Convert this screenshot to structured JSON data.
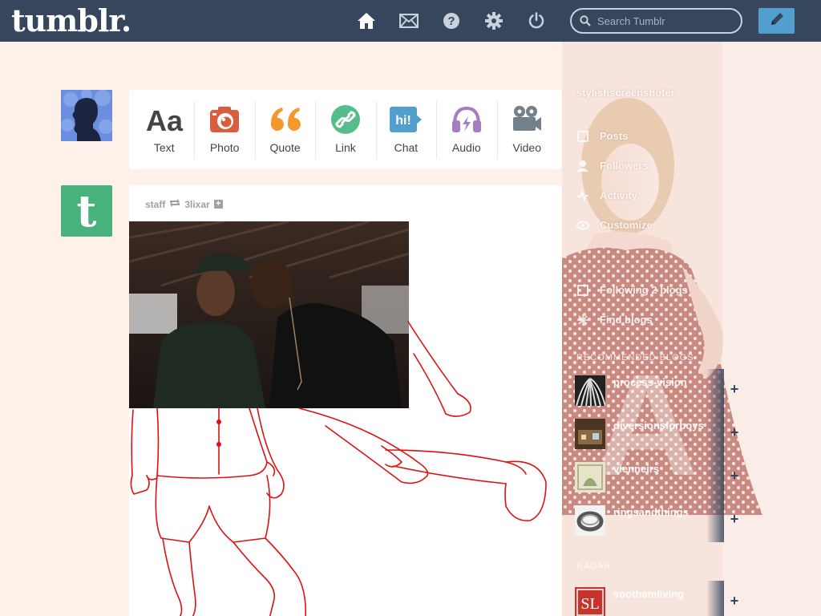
{
  "header": {
    "logo": "tumblr.",
    "search_placeholder": "Search Tumblr",
    "colors": {
      "bar": "#36465d",
      "compose": "#529ecc"
    }
  },
  "post_types": [
    {
      "label": "Text",
      "icon": "text-icon",
      "color": "#444444"
    },
    {
      "label": "Photo",
      "icon": "camera-icon",
      "color": "#d95e40"
    },
    {
      "label": "Quote",
      "icon": "quote-icon",
      "color": "#f2992e"
    },
    {
      "label": "Link",
      "icon": "link-icon",
      "color": "#56bc8a"
    },
    {
      "label": "Chat",
      "icon": "chat-icon",
      "color": "#529ecc"
    },
    {
      "label": "Audio",
      "icon": "headphones-icon",
      "color": "#a77dc2"
    },
    {
      "label": "Video",
      "icon": "video-camera-icon",
      "color": "#748089"
    }
  ],
  "post": {
    "author": "staff",
    "reblogged_from": "3lixar"
  },
  "sidebar": {
    "blog_name": "stylishscreenshoter",
    "menu": [
      {
        "label": "Posts",
        "icon": "posts-icon"
      },
      {
        "label": "Followers",
        "icon": "followers-icon"
      },
      {
        "label": "Activity",
        "icon": "activity-icon"
      },
      {
        "label": "Customize",
        "icon": "eye-icon"
      }
    ],
    "menu2": [
      {
        "label": "Following 2 blogs",
        "icon": "following-icon"
      },
      {
        "label": "Find blogs",
        "icon": "find-icon"
      }
    ],
    "recommended_heading": "RECOMMENDED BLOGS",
    "recommended": [
      {
        "name": "process-vision",
        "sub": ""
      },
      {
        "name": "diversionsforboys",
        "sub": ""
      },
      {
        "name": "vienneirs",
        "sub": ""
      },
      {
        "name": "ringsandthings",
        "sub": ""
      }
    ],
    "radar_heading": "RADAR",
    "radar": {
      "name": "soothemliving",
      "sub": ""
    }
  }
}
